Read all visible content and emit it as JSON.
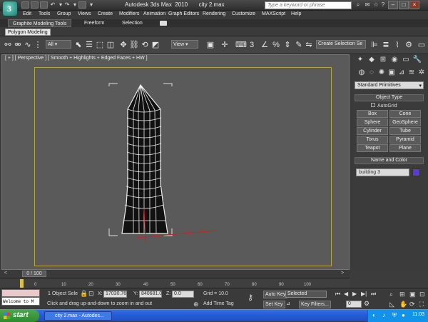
{
  "titlebar": {
    "title": "Autodesk 3ds Max  2010       city 2.max",
    "search_placeholder": "Type a keyword or phrase"
  },
  "menu": [
    "Edit",
    "Tools",
    "Group",
    "Views",
    "Create",
    "Modifiers",
    "Animation",
    "Graph Editors",
    "Rendering",
    "Customize",
    "MAXScript",
    "Help"
  ],
  "ribbon": {
    "tabs": [
      "Graphite Modeling Tools",
      "Freeform",
      "Selection"
    ],
    "active_tab": "Graphite Modeling Tools",
    "panel_button": "Polygon Modeling"
  },
  "toolbar": {
    "filter": "All",
    "ref_coord": "View",
    "selection_set": "Create Selection Se",
    "numbers": [
      "3",
      "%"
    ]
  },
  "viewport": {
    "label": "[ + ] [ Perspective ] [ Smooth + Highlights + Edged Faces + HW ]"
  },
  "command_panel": {
    "category": "Standard Primitives",
    "object_type_title": "Object Type",
    "autogrid_label": "AutoGrid",
    "buttons": [
      "Box",
      "Cone",
      "Sphere",
      "GeoSphere",
      "Cylinder",
      "Tube",
      "Torus",
      "Pyramid",
      "Teapot",
      "Plane"
    ],
    "name_color_title": "Name and Color",
    "object_name": "building 3",
    "object_color": "#5a3dcc"
  },
  "timeslider": {
    "position": "0 / 100",
    "ticks": [
      "0",
      "10",
      "20",
      "30",
      "40",
      "50",
      "60",
      "70",
      "80",
      "90",
      "100"
    ]
  },
  "status": {
    "selection": "1 Object Sele",
    "x_label": "X:",
    "x": "17030.76",
    "y_label": "Y:",
    "y": "840681.06",
    "z_label": "Z:",
    "z": "0.0",
    "grid": "Grid = 10.0",
    "prompt": "Click and drag up-and-down to zoom in and out",
    "add_time_tag": "Add Time Tag",
    "auto_key": "Auto Key",
    "selected": "Selected",
    "set_key": "Set Key",
    "key_filters": "Key Filters...",
    "frame": "0",
    "maxscript": "Welcome to M"
  },
  "taskbar": {
    "start": "start",
    "task": "city 2.max - Autodes...",
    "clock": "11:03"
  }
}
